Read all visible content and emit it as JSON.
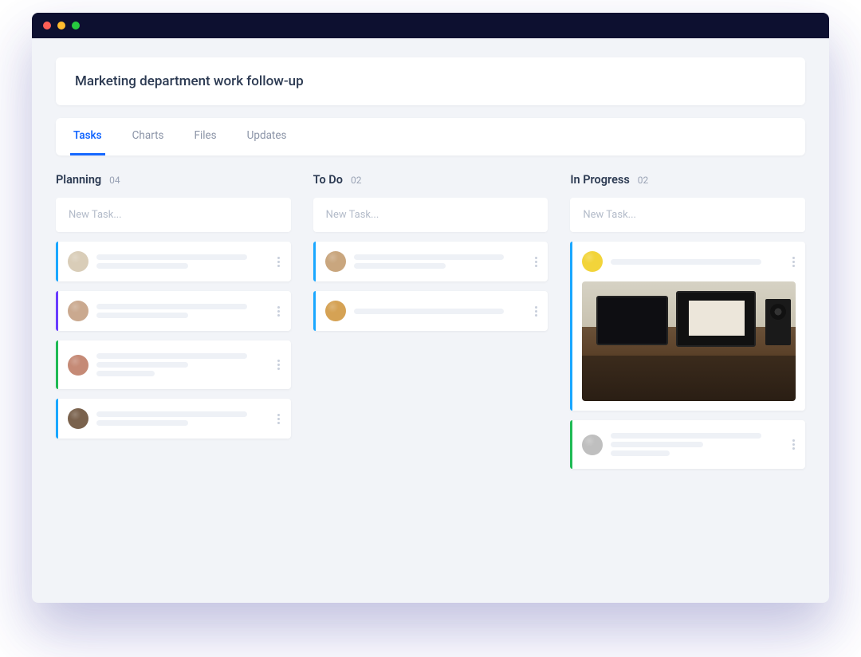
{
  "header": {
    "title": "Marketing department work follow-up"
  },
  "tabs": [
    {
      "label": "Tasks",
      "active": true
    },
    {
      "label": "Charts",
      "active": false
    },
    {
      "label": "Files",
      "active": false
    },
    {
      "label": "Updates",
      "active": false
    }
  ],
  "new_task_placeholder": "New Task...",
  "columns": [
    {
      "title": "Planning",
      "count": "04",
      "cards": [
        {
          "accent": "#1aa7ff",
          "avatar_bg": "#d9cdb8",
          "lines": 2
        },
        {
          "accent": "#6a3cff",
          "avatar_bg": "#caa98f",
          "lines": 2
        },
        {
          "accent": "#1fba55",
          "avatar_bg": "#c58a76",
          "lines": 3
        },
        {
          "accent": "#1aa7ff",
          "avatar_bg": "#7a624d",
          "lines": 2
        }
      ]
    },
    {
      "title": "To Do",
      "count": "02",
      "cards": [
        {
          "accent": "#1aa7ff",
          "avatar_bg": "#c9a67e",
          "lines": 2
        },
        {
          "accent": "#1aa7ff",
          "avatar_bg": "#d5a254",
          "lines": 1
        }
      ]
    },
    {
      "title": "In Progress",
      "count": "02",
      "cards": [
        {
          "accent": "#1aa7ff",
          "avatar_bg": "#f2d43a",
          "lines": 1,
          "image": true
        },
        {
          "accent": "#1fba55",
          "avatar_bg": "#bfbfbf",
          "lines": 3
        }
      ]
    }
  ]
}
